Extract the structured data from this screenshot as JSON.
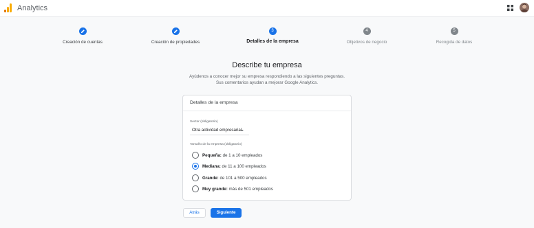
{
  "header": {
    "app_title": "Analytics",
    "logo_icon": "analytics-logo",
    "apps_icon": "apps-grid-icon",
    "avatar_icon": "user-avatar"
  },
  "stepper": {
    "steps": [
      {
        "number": "1",
        "label": "Creación de cuentas",
        "state": "done"
      },
      {
        "number": "2",
        "label": "Creación de propiedades",
        "state": "done"
      },
      {
        "number": "3",
        "label": "Detalles de la empresa",
        "state": "active"
      },
      {
        "number": "4",
        "label": "Objetivos de negocio",
        "state": "todo"
      },
      {
        "number": "5",
        "label": "Recogida de datos",
        "state": "todo"
      }
    ]
  },
  "main": {
    "title": "Describe tu empresa",
    "subtitle_line1": "Ayúdenos a conocer mejor su empresa respondiendo a las siguientes preguntas.",
    "subtitle_line2": "Sus comentarios ayudan a mejorar Google Analytics."
  },
  "card": {
    "title": "Detalles de la empresa",
    "sector_label": "Sector (obligatorio)",
    "sector_value": "Otra actividad empresarial",
    "size_label": "Tamaño de la empresa (obligatorio)",
    "size_options": [
      {
        "bold": "Pequeña:",
        "text": " de 1 a 10 empleados",
        "checked": false
      },
      {
        "bold": "Mediana:",
        "text": " de 11 a 100 empleados",
        "checked": true
      },
      {
        "bold": "Grande:",
        "text": " de 101 a 500 empleados",
        "checked": false
      },
      {
        "bold": "Muy grande:",
        "text": " más de 501 empleados",
        "checked": false
      }
    ]
  },
  "actions": {
    "back_label": "Atrás",
    "next_label": "Siguiente"
  },
  "colors": {
    "accent": "#1a73e8",
    "inactive_step": "#80868b",
    "logo_orange": "#f9ab00",
    "logo_dark_orange": "#e37400"
  }
}
